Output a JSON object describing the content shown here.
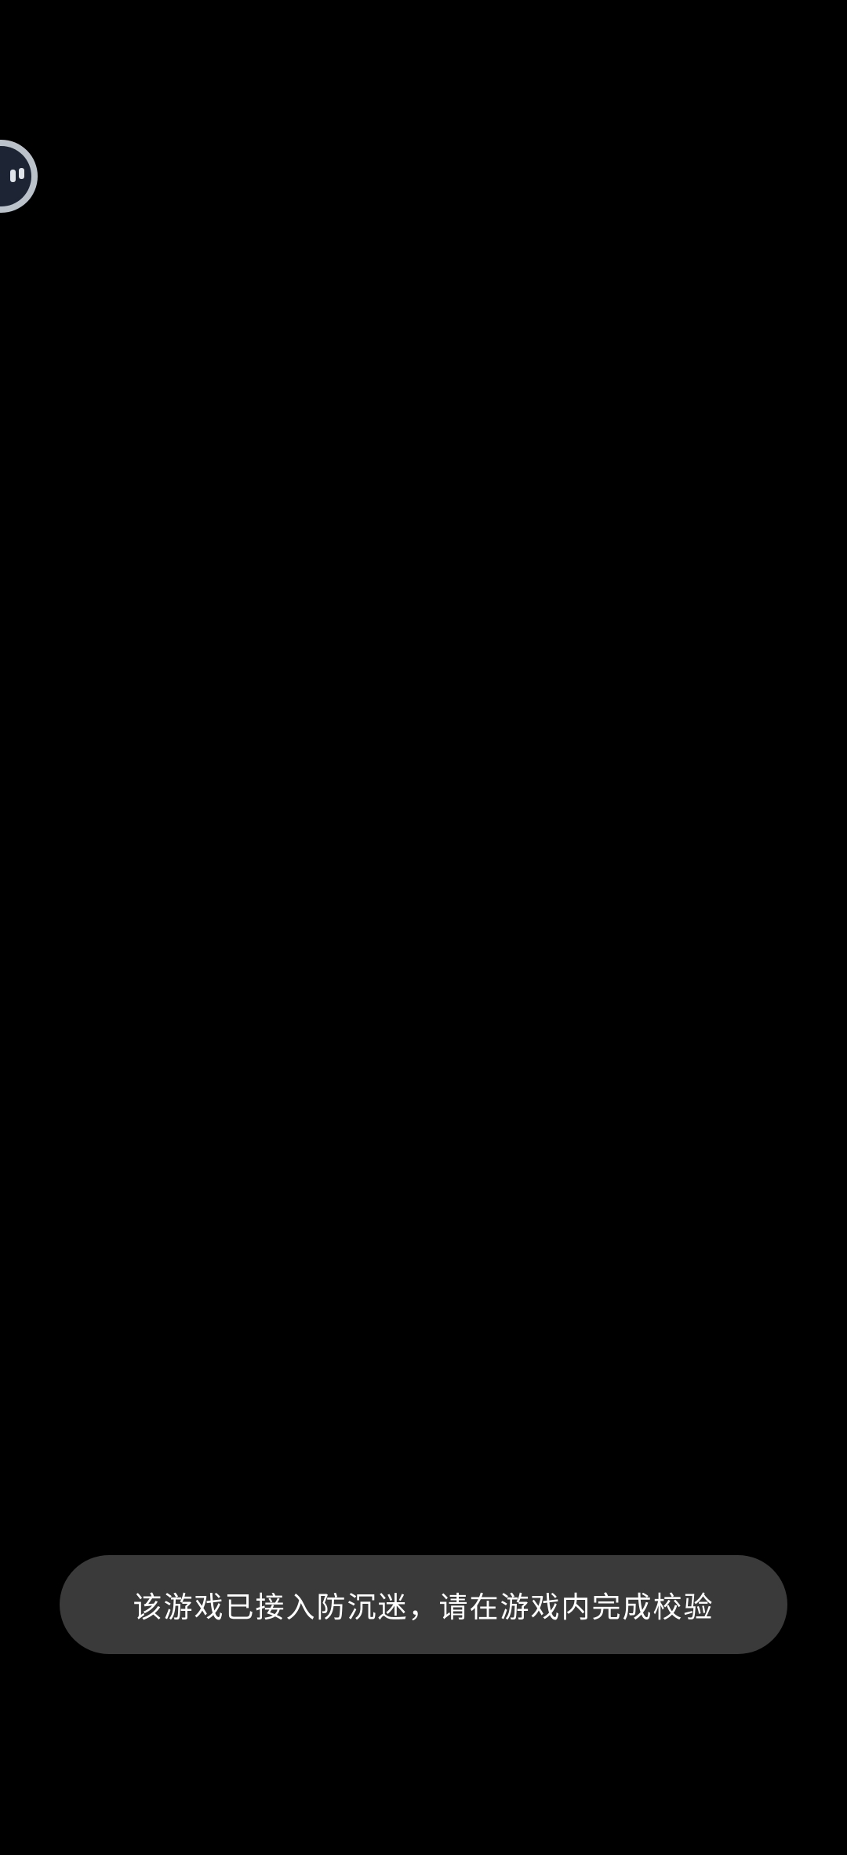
{
  "screen": {
    "background": "#000000"
  },
  "float_ball": {
    "icon": "assistant-face-icon",
    "ring_color": "#bcc2c9",
    "face_color": "#1d2433"
  },
  "toast": {
    "message": "该游戏已接入防沉迷，请在游戏内完成校验",
    "background": "#3a3a3a",
    "text_color": "#ffffff"
  }
}
